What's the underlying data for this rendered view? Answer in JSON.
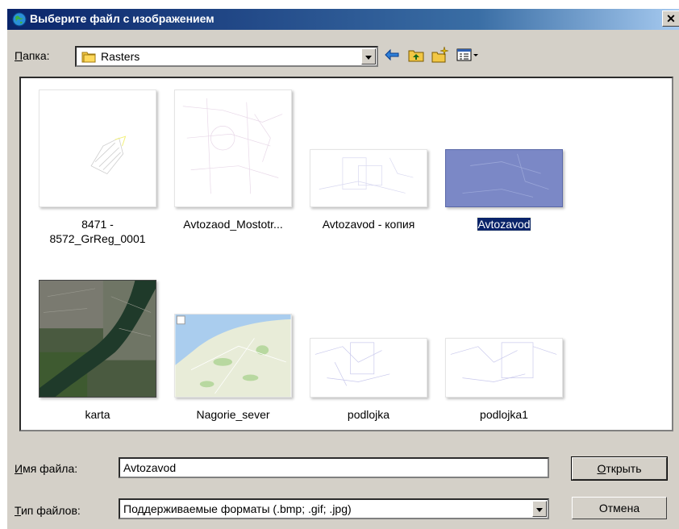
{
  "dialog": {
    "title": "Выберите файл с изображением",
    "close_glyph": "✕"
  },
  "folder": {
    "label": "Папка:",
    "value": "Rasters",
    "icon": "folder-icon"
  },
  "toolbar": {
    "back_icon": "back-arrow-icon",
    "up_icon": "up-folder-icon",
    "new_folder_icon": "new-folder-icon",
    "view_menu_icon": "view-menu-icon"
  },
  "files": [
    {
      "name": "8471 -\n8572_GrReg_0001",
      "selected": false
    },
    {
      "name": "Avtozaod_Mostotr...",
      "selected": false
    },
    {
      "name": "Avtozavod - копия",
      "selected": false
    },
    {
      "name": "Avtozavod",
      "selected": true
    },
    {
      "name": "karta",
      "selected": false
    },
    {
      "name": "Nagorie_sever",
      "selected": false
    },
    {
      "name": "podlojka",
      "selected": false
    },
    {
      "name": "podlojka1",
      "selected": false
    }
  ],
  "filename": {
    "label": "Имя файла:",
    "value": "Avtozavod"
  },
  "filetype": {
    "label": "Тип файлов:",
    "value": "Поддерживаемые форматы (.bmp; .gif; .jpg)"
  },
  "buttons": {
    "open": "Открыть",
    "cancel": "Отмена"
  },
  "colors": {
    "titlebar": "#0a246a",
    "selection": "#0a246a",
    "face": "#d4d0c8"
  }
}
